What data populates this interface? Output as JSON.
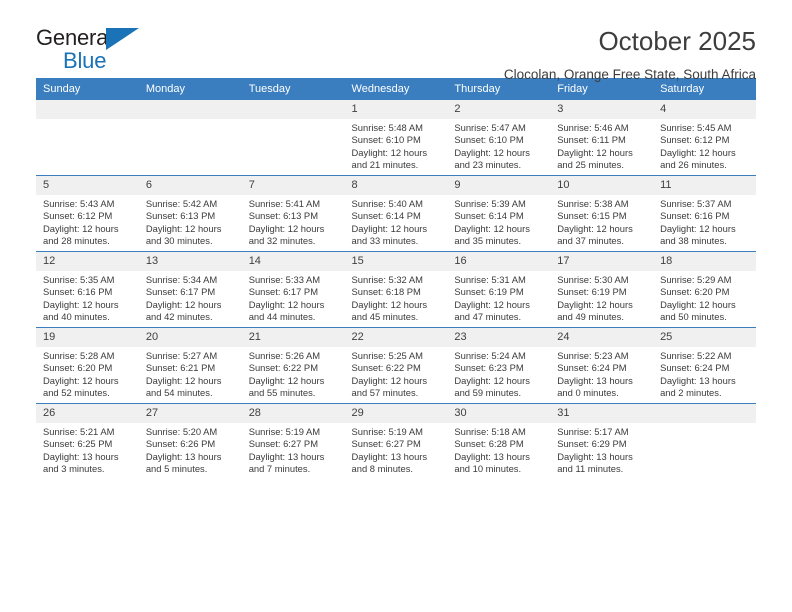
{
  "brand": {
    "word_one": "General",
    "word_two": "Blue",
    "triangle_icon": "triangle-icon"
  },
  "header": {
    "month_title": "October 2025",
    "location": "Clocolan, Orange Free State, South Africa"
  },
  "colors": {
    "header_blue": "#3a7ebf",
    "brand_blue": "#1a73b7",
    "daynum_band": "#f0f0f0",
    "text": "#3b3b3b"
  },
  "weekday_headers": [
    "Sunday",
    "Monday",
    "Tuesday",
    "Wednesday",
    "Thursday",
    "Friday",
    "Saturday"
  ],
  "labels": {
    "sunrise": "Sunrise:",
    "sunset": "Sunset:",
    "daylight": "Daylight:"
  },
  "weeks": [
    [
      {
        "day": "",
        "empty": true
      },
      {
        "day": "",
        "empty": true
      },
      {
        "day": "",
        "empty": true
      },
      {
        "day": "1",
        "sunrise": "Sunrise: 5:48 AM",
        "sunset": "Sunset: 6:10 PM",
        "daylight": "Daylight: 12 hours and 21 minutes."
      },
      {
        "day": "2",
        "sunrise": "Sunrise: 5:47 AM",
        "sunset": "Sunset: 6:10 PM",
        "daylight": "Daylight: 12 hours and 23 minutes."
      },
      {
        "day": "3",
        "sunrise": "Sunrise: 5:46 AM",
        "sunset": "Sunset: 6:11 PM",
        "daylight": "Daylight: 12 hours and 25 minutes."
      },
      {
        "day": "4",
        "sunrise": "Sunrise: 5:45 AM",
        "sunset": "Sunset: 6:12 PM",
        "daylight": "Daylight: 12 hours and 26 minutes."
      }
    ],
    [
      {
        "day": "5",
        "sunrise": "Sunrise: 5:43 AM",
        "sunset": "Sunset: 6:12 PM",
        "daylight": "Daylight: 12 hours and 28 minutes."
      },
      {
        "day": "6",
        "sunrise": "Sunrise: 5:42 AM",
        "sunset": "Sunset: 6:13 PM",
        "daylight": "Daylight: 12 hours and 30 minutes."
      },
      {
        "day": "7",
        "sunrise": "Sunrise: 5:41 AM",
        "sunset": "Sunset: 6:13 PM",
        "daylight": "Daylight: 12 hours and 32 minutes."
      },
      {
        "day": "8",
        "sunrise": "Sunrise: 5:40 AM",
        "sunset": "Sunset: 6:14 PM",
        "daylight": "Daylight: 12 hours and 33 minutes."
      },
      {
        "day": "9",
        "sunrise": "Sunrise: 5:39 AM",
        "sunset": "Sunset: 6:14 PM",
        "daylight": "Daylight: 12 hours and 35 minutes."
      },
      {
        "day": "10",
        "sunrise": "Sunrise: 5:38 AM",
        "sunset": "Sunset: 6:15 PM",
        "daylight": "Daylight: 12 hours and 37 minutes."
      },
      {
        "day": "11",
        "sunrise": "Sunrise: 5:37 AM",
        "sunset": "Sunset: 6:16 PM",
        "daylight": "Daylight: 12 hours and 38 minutes."
      }
    ],
    [
      {
        "day": "12",
        "sunrise": "Sunrise: 5:35 AM",
        "sunset": "Sunset: 6:16 PM",
        "daylight": "Daylight: 12 hours and 40 minutes."
      },
      {
        "day": "13",
        "sunrise": "Sunrise: 5:34 AM",
        "sunset": "Sunset: 6:17 PM",
        "daylight": "Daylight: 12 hours and 42 minutes."
      },
      {
        "day": "14",
        "sunrise": "Sunrise: 5:33 AM",
        "sunset": "Sunset: 6:17 PM",
        "daylight": "Daylight: 12 hours and 44 minutes."
      },
      {
        "day": "15",
        "sunrise": "Sunrise: 5:32 AM",
        "sunset": "Sunset: 6:18 PM",
        "daylight": "Daylight: 12 hours and 45 minutes."
      },
      {
        "day": "16",
        "sunrise": "Sunrise: 5:31 AM",
        "sunset": "Sunset: 6:19 PM",
        "daylight": "Daylight: 12 hours and 47 minutes."
      },
      {
        "day": "17",
        "sunrise": "Sunrise: 5:30 AM",
        "sunset": "Sunset: 6:19 PM",
        "daylight": "Daylight: 12 hours and 49 minutes."
      },
      {
        "day": "18",
        "sunrise": "Sunrise: 5:29 AM",
        "sunset": "Sunset: 6:20 PM",
        "daylight": "Daylight: 12 hours and 50 minutes."
      }
    ],
    [
      {
        "day": "19",
        "sunrise": "Sunrise: 5:28 AM",
        "sunset": "Sunset: 6:20 PM",
        "daylight": "Daylight: 12 hours and 52 minutes."
      },
      {
        "day": "20",
        "sunrise": "Sunrise: 5:27 AM",
        "sunset": "Sunset: 6:21 PM",
        "daylight": "Daylight: 12 hours and 54 minutes."
      },
      {
        "day": "21",
        "sunrise": "Sunrise: 5:26 AM",
        "sunset": "Sunset: 6:22 PM",
        "daylight": "Daylight: 12 hours and 55 minutes."
      },
      {
        "day": "22",
        "sunrise": "Sunrise: 5:25 AM",
        "sunset": "Sunset: 6:22 PM",
        "daylight": "Daylight: 12 hours and 57 minutes."
      },
      {
        "day": "23",
        "sunrise": "Sunrise: 5:24 AM",
        "sunset": "Sunset: 6:23 PM",
        "daylight": "Daylight: 12 hours and 59 minutes."
      },
      {
        "day": "24",
        "sunrise": "Sunrise: 5:23 AM",
        "sunset": "Sunset: 6:24 PM",
        "daylight": "Daylight: 13 hours and 0 minutes."
      },
      {
        "day": "25",
        "sunrise": "Sunrise: 5:22 AM",
        "sunset": "Sunset: 6:24 PM",
        "daylight": "Daylight: 13 hours and 2 minutes."
      }
    ],
    [
      {
        "day": "26",
        "sunrise": "Sunrise: 5:21 AM",
        "sunset": "Sunset: 6:25 PM",
        "daylight": "Daylight: 13 hours and 3 minutes."
      },
      {
        "day": "27",
        "sunrise": "Sunrise: 5:20 AM",
        "sunset": "Sunset: 6:26 PM",
        "daylight": "Daylight: 13 hours and 5 minutes."
      },
      {
        "day": "28",
        "sunrise": "Sunrise: 5:19 AM",
        "sunset": "Sunset: 6:27 PM",
        "daylight": "Daylight: 13 hours and 7 minutes."
      },
      {
        "day": "29",
        "sunrise": "Sunrise: 5:19 AM",
        "sunset": "Sunset: 6:27 PM",
        "daylight": "Daylight: 13 hours and 8 minutes."
      },
      {
        "day": "30",
        "sunrise": "Sunrise: 5:18 AM",
        "sunset": "Sunset: 6:28 PM",
        "daylight": "Daylight: 13 hours and 10 minutes."
      },
      {
        "day": "31",
        "sunrise": "Sunrise: 5:17 AM",
        "sunset": "Sunset: 6:29 PM",
        "daylight": "Daylight: 13 hours and 11 minutes."
      },
      {
        "day": "",
        "empty": true
      }
    ]
  ]
}
